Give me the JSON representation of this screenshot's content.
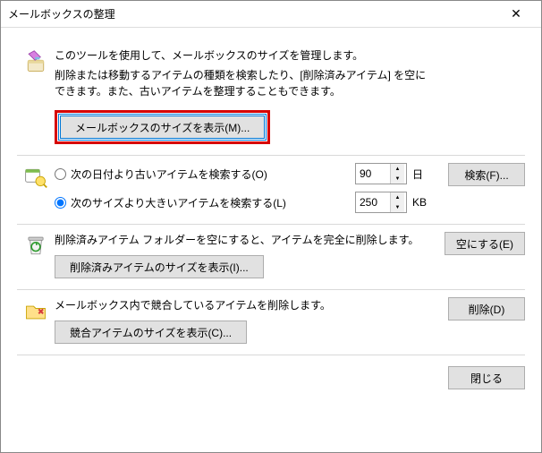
{
  "titlebar": {
    "title": "メールボックスの整理"
  },
  "intro": {
    "line1": "このツールを使用して、メールボックスのサイズを管理します。",
    "line2": "削除または移動するアイテムの種類を検索したり、[削除済みアイテム] を空にできます。また、古いアイテムを整理することもできます。",
    "button": "メールボックスのサイズを表示(M)..."
  },
  "find": {
    "older_label": "次の日付より古いアイテムを検索する(O)",
    "larger_label": "次のサイズより大きいアイテムを検索する(L)",
    "older_value": "90",
    "older_unit": "日",
    "larger_value": "250",
    "larger_unit": "KB",
    "button": "検索(F)..."
  },
  "deleted": {
    "text": "削除済みアイテム フォルダーを空にすると、アイテムを完全に削除します。",
    "size_button": "削除済みアイテムのサイズを表示(I)...",
    "empty_button": "空にする(E)"
  },
  "conflicts": {
    "text": "メールボックス内で競合しているアイテムを削除します。",
    "size_button": "競合アイテムのサイズを表示(C)...",
    "delete_button": "削除(D)"
  },
  "footer": {
    "close": "閉じる"
  }
}
